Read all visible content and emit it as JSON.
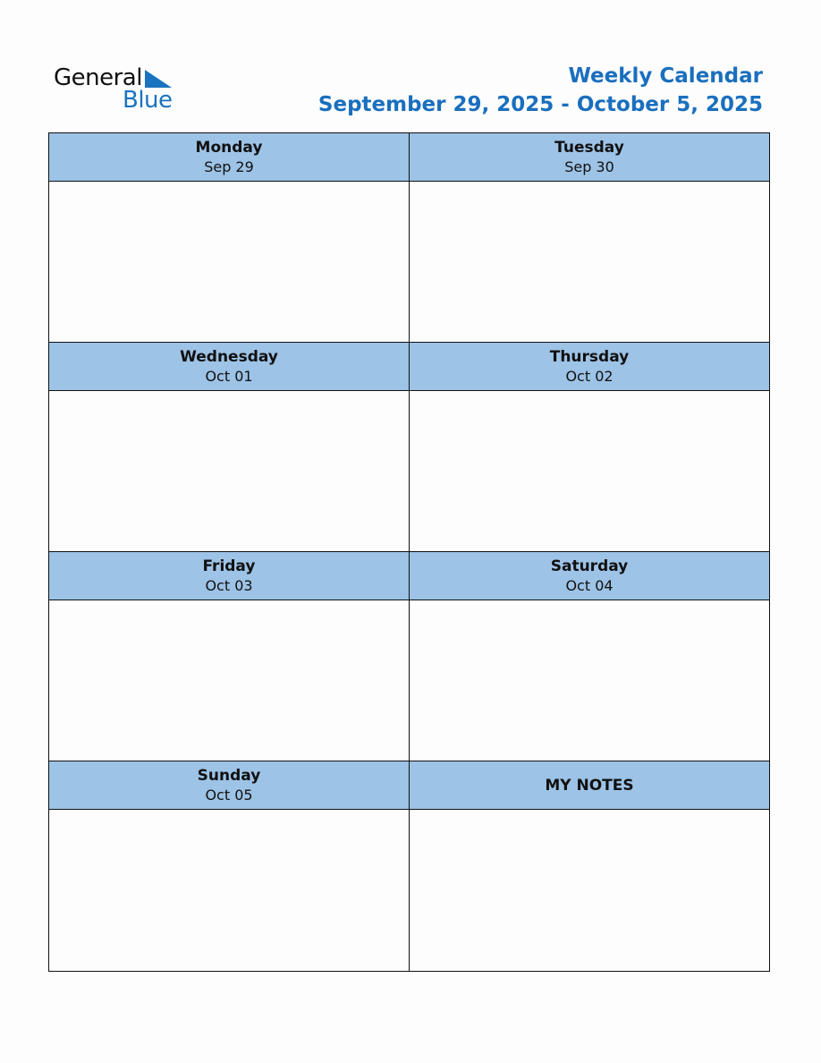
{
  "logo": {
    "line1": "General",
    "line2": "Blue"
  },
  "header": {
    "title": "Weekly Calendar",
    "range": "September 29, 2025 - October 5, 2025"
  },
  "days": [
    {
      "name": "Monday",
      "date": "Sep 29"
    },
    {
      "name": "Tuesday",
      "date": "Sep 30"
    },
    {
      "name": "Wednesday",
      "date": "Oct 01"
    },
    {
      "name": "Thursday",
      "date": "Oct 02"
    },
    {
      "name": "Friday",
      "date": "Oct 03"
    },
    {
      "name": "Saturday",
      "date": "Oct 04"
    },
    {
      "name": "Sunday",
      "date": "Oct 05"
    }
  ],
  "notes": {
    "label": "MY NOTES"
  },
  "colors": {
    "accent": "#1a6fbe",
    "header_fill": "#9dc3e6"
  }
}
